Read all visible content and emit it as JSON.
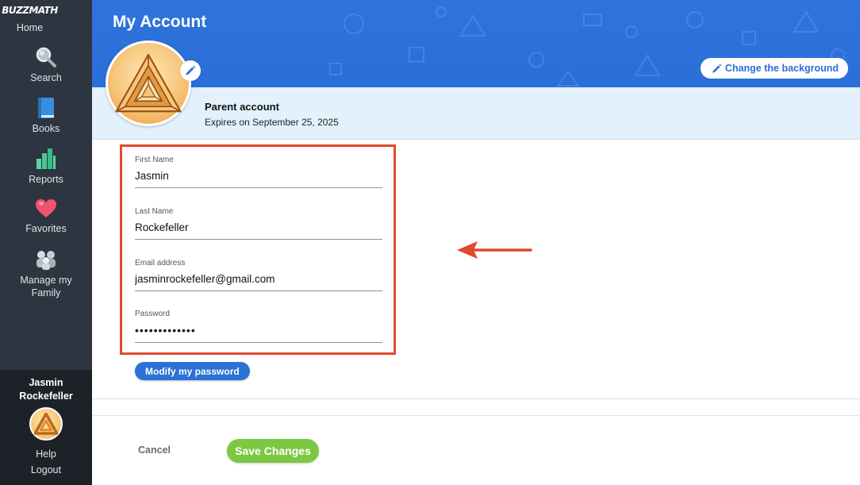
{
  "sidebar": {
    "logo_text": "BUZZMATH",
    "items": [
      {
        "label": "Home",
        "icon": "home-logo"
      },
      {
        "label": "Search",
        "icon": "magnifier-icon"
      },
      {
        "label": "Books",
        "icon": "book-icon"
      },
      {
        "label": "Reports",
        "icon": "bar-chart-icon"
      },
      {
        "label": "Favorites",
        "icon": "heart-icon"
      },
      {
        "label": "Manage my Family",
        "icon": "family-icon"
      }
    ],
    "user": {
      "first": "Jasmin",
      "last": "Rockefeller"
    },
    "help_label": "Help",
    "logout_label": "Logout"
  },
  "header": {
    "title": "My Account",
    "change_background_label": "Change the background",
    "accent_color": "#2a6fd8"
  },
  "account": {
    "type": "Parent account",
    "expires": "Expires on September 25, 2025"
  },
  "form": {
    "first_name": {
      "label": "First Name",
      "value": "Jasmin"
    },
    "last_name": {
      "label": "Last Name",
      "value": "Rockefeller"
    },
    "email": {
      "label": "Email address",
      "value": "jasminrockefeller@gmail.com"
    },
    "password": {
      "label": "Password",
      "value": "•••••••••••••"
    },
    "modify_password_label": "Modify my password"
  },
  "actions": {
    "cancel_label": "Cancel",
    "save_label": "Save Changes",
    "save_color": "#7dc842"
  },
  "annotation": {
    "highlight_color": "#e04a2d"
  }
}
